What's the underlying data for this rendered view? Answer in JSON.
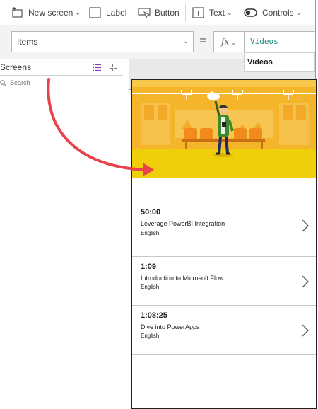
{
  "toolbar": {
    "new_screen_label": "New screen",
    "label_label": "Label",
    "button_label": "Button",
    "text_label": "Text",
    "controls_label": "Controls"
  },
  "formula_bar": {
    "property": "Items",
    "equals": "=",
    "fx": "fx",
    "value": "Videos",
    "suggestion": "Videos"
  },
  "screens_pane": {
    "title": "Screens",
    "search_placeholder": "Search"
  },
  "gallery": {
    "items": [
      {
        "duration": "50:00",
        "title": "Leverage PowerBI Integration",
        "language": "English"
      },
      {
        "duration": "1:09",
        "title": "Introduction to Microsoft Flow",
        "language": "English"
      },
      {
        "duration": "1:08:25",
        "title": "Dive into PowerApps",
        "language": "English"
      }
    ]
  },
  "colors": {
    "banner_background": "#F4B52A",
    "banner_floor": "#EFCE0A",
    "seat_orange": "#F28A1C",
    "annotation_arrow": "#E8434C",
    "formula_value": "#1A8C7A"
  },
  "icons": [
    "new-screen-icon",
    "label-icon",
    "button-icon",
    "text-icon",
    "controls-toggle-icon",
    "chevron-down-icon",
    "list-view-icon",
    "grid-view-icon",
    "search-icon",
    "next-arrow-icon"
  ]
}
